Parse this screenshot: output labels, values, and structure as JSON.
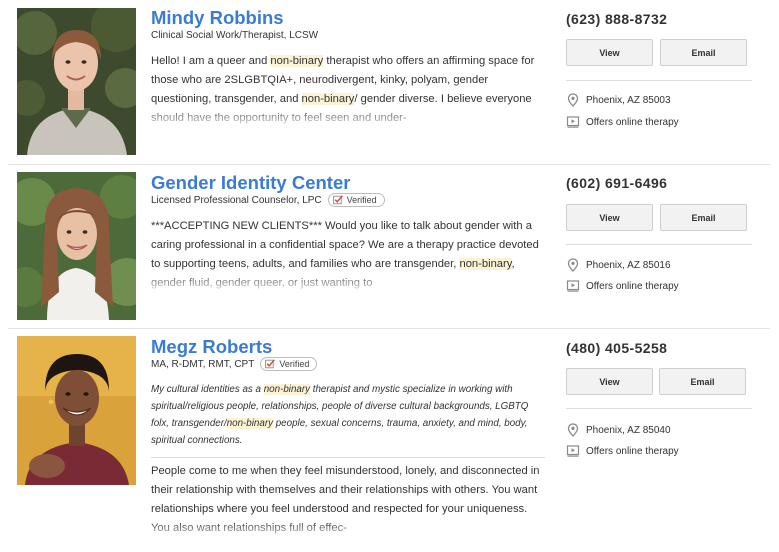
{
  "listings": [
    {
      "name": "Mindy Robbins",
      "credentials": "Clinical Social Work/Therapist, LCSW",
      "verified": false,
      "description": {
        "segments": [
          {
            "t": "Hello! I am a queer and "
          },
          {
            "t": "non-binary",
            "hl": true
          },
          {
            "t": " therapist who offers an affirming space for those who are 2SLGBTQIA+, neurodivergent, kinky, polyam, gender questioning, transgender, and "
          },
          {
            "t": "non-binary",
            "hl": true
          },
          {
            "t": "/ gender diverse. I believe everyone should have the opportunity to feel seen and under-"
          }
        ]
      },
      "phone": "(623) 888-8732",
      "view_label": "View",
      "email_label": "Email",
      "location": "Phoenix, AZ 85003",
      "online": "Offers online therapy"
    },
    {
      "name": "Gender Identity Center",
      "credentials": "Licensed Professional Counselor, LPC",
      "verified": true,
      "verified_label": "Verified",
      "description": {
        "segments": [
          {
            "t": "***ACCEPTING NEW CLIENTS*** Would you like to talk about gender with a caring professional in a confidential space? We are a therapy practice devoted to supporting teens, adults, and families who are transgender, "
          },
          {
            "t": "non-binary",
            "hl": true
          },
          {
            "t": ", gender fluid, gender queer, or just wanting to"
          }
        ]
      },
      "phone": "(602) 691-6496",
      "view_label": "View",
      "email_label": "Email",
      "location": "Phoenix, AZ 85016",
      "online": "Offers online therapy"
    },
    {
      "name": "Megz Roberts",
      "credentials": "MA, R-DMT, RMT, CPT",
      "verified": true,
      "verified_label": "Verified",
      "statement": {
        "segments": [
          {
            "t": "My cultural identities as a "
          },
          {
            "t": "non-binary",
            "hl": true
          },
          {
            "t": " therapist and mystic specialize in working with spiritual/religious people, relationships, people of diverse cultural backgrounds, LGBTQ folx, transgender/"
          },
          {
            "t": "non-binary",
            "hl": true
          },
          {
            "t": " people, sexual concerns, trauma, anxiety, and mind, body, spiritual connections."
          }
        ]
      },
      "description": {
        "segments": [
          {
            "t": "People come to me when they feel misunderstood, lonely, and disconnected in their relationship with themselves and their relationships with others. You want relationships where you feel understood and respected for your uniqueness. You also want relationships full of effec-"
          }
        ]
      },
      "phone": "(480) 405-5258",
      "view_label": "View",
      "email_label": "Email",
      "location": "Phoenix, AZ 85040",
      "online": "Offers online therapy"
    }
  ],
  "colors": {
    "name_link": "#3a7bd5",
    "highlight": "#fcf3d4",
    "verified_check": "#d0463a",
    "icon_gray": "#8a8a8a"
  },
  "icons": {
    "location": "map-pin-icon",
    "online": "video-screen-icon",
    "verified": "checkbox-check-icon"
  }
}
